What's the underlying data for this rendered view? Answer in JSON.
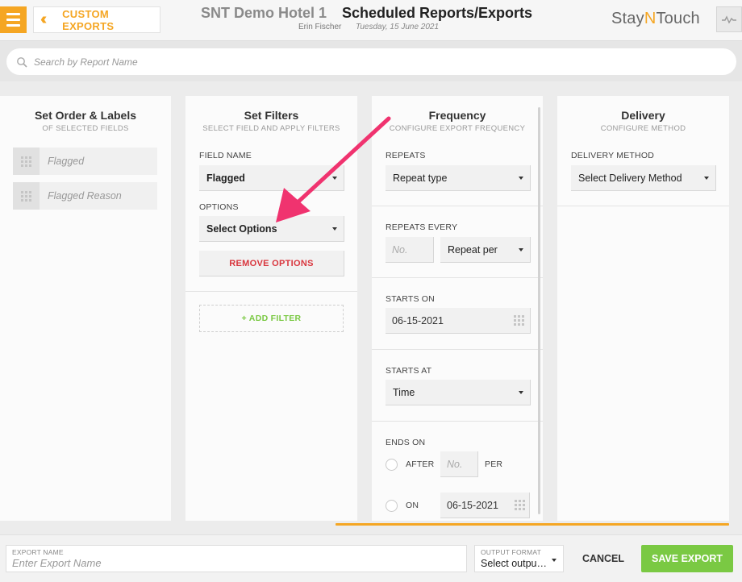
{
  "header": {
    "back_label": "CUSTOM EXPORTS",
    "hotel_name": "SNT Demo Hotel 1",
    "page_title": "Scheduled Reports/Exports",
    "user_name": "Erin Fischer",
    "date": "Tuesday, 15 June 2021",
    "logo_part1": "Stay",
    "logo_part2": "N",
    "logo_part3": "Touch",
    "accent_color": "#f5a623"
  },
  "search": {
    "placeholder": "Search by Report Name"
  },
  "order_panel": {
    "title": "Set Order & Labels",
    "subtitle": "OF SELECTED FIELDS",
    "fields": [
      "Flagged",
      "Flagged Reason"
    ]
  },
  "filters_panel": {
    "title": "Set Filters",
    "subtitle": "SELECT FIELD AND APPLY FILTERS",
    "field_name_label": "FIELD NAME",
    "field_name_value": "Flagged",
    "options_label": "OPTIONS",
    "options_value": "Select Options",
    "remove_label": "REMOVE OPTIONS",
    "add_filter_label": "+ ADD FILTER",
    "remove_color": "#d9363e",
    "add_color": "#7ac943"
  },
  "frequency_panel": {
    "title": "Frequency",
    "subtitle": "CONFIGURE EXPORT FREQUENCY",
    "repeats_label": "REPEATS",
    "repeats_value": "Repeat type",
    "repeats_every_label": "REPEATS EVERY",
    "repeats_every_placeholder": "No.",
    "repeats_per_value": "Repeat per",
    "starts_on_label": "STARTS ON",
    "starts_on_value": "06-15-2021",
    "starts_at_label": "STARTS AT",
    "starts_at_value": "Time",
    "ends_on_label": "ENDS ON",
    "after_label": "AFTER",
    "after_placeholder": "No.",
    "per_label": "PER",
    "on_label": "ON",
    "on_value": "06-15-2021"
  },
  "delivery_panel": {
    "title": "Delivery",
    "subtitle": "CONFIGURE METHOD",
    "method_label": "DELIVERY METHOD",
    "method_value": "Select Delivery Method"
  },
  "footer": {
    "export_name_label": "EXPORT NAME",
    "export_name_placeholder": "Enter Export Name",
    "output_format_label": "OUTPUT FORMAT",
    "output_format_value": "Select output format",
    "cancel_label": "CANCEL",
    "save_label": "SAVE EXPORT",
    "save_color": "#7ac943"
  },
  "annotation": {
    "arrow_color": "#f0336f"
  }
}
